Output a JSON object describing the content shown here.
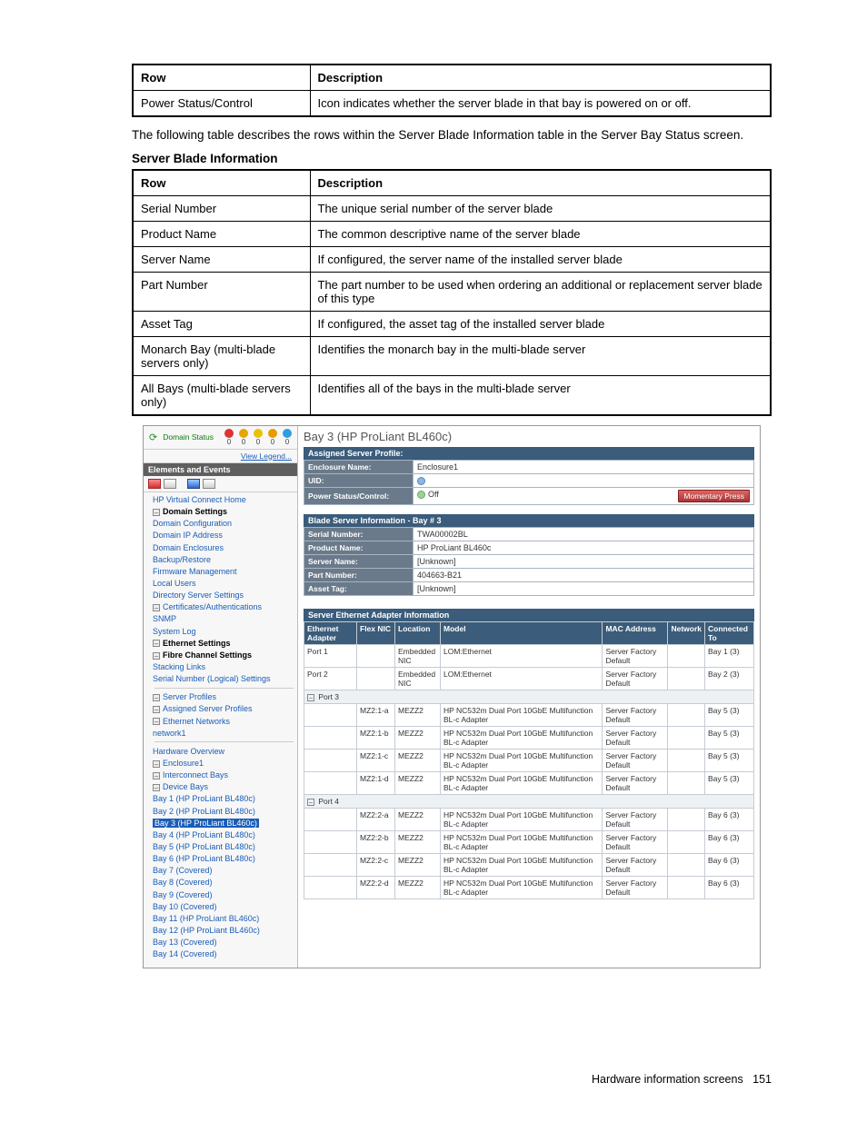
{
  "table1": {
    "headers": [
      "Row",
      "Description"
    ],
    "rows": [
      [
        "Power Status/Control",
        "Icon indicates whether the server blade in that bay is powered on or off."
      ]
    ]
  },
  "para1": "The following table describes the rows within the Server Blade Information table in the Server Bay Status screen.",
  "subhead1": "Server Blade Information",
  "table2": {
    "headers": [
      "Row",
      "Description"
    ],
    "rows": [
      [
        "Serial Number",
        "The unique serial number of the server blade"
      ],
      [
        "Product Name",
        "The common descriptive name of the server blade"
      ],
      [
        "Server Name",
        "If configured, the server name of the installed server blade"
      ],
      [
        "Part Number",
        "The part number to be used when ordering an additional or replacement server blade of this type"
      ],
      [
        "Asset Tag",
        "If configured, the asset tag of the installed server blade"
      ],
      [
        "Monarch Bay (multi-blade servers only)",
        "Identifies the monarch bay in the multi-blade server"
      ],
      [
        "All Bays (multi-blade servers only)",
        "Identifies all of the bays in the multi-blade server"
      ]
    ]
  },
  "shot": {
    "status": {
      "label": "Domain Status",
      "counts": [
        "0",
        "0",
        "0",
        "0",
        "0"
      ]
    },
    "view_legend": "View Legend...",
    "side_header": "Elements and Events",
    "tree": {
      "vc_home": "HP Virtual Connect Home",
      "domain_settings": "Domain Settings",
      "domain_config": "Domain Configuration",
      "domain_ip": "Domain IP Address",
      "domain_enc": "Domain Enclosures",
      "backup": "Backup/Restore",
      "fw": "Firmware Management",
      "local_users": "Local Users",
      "dir_set": "Directory Server Settings",
      "certs": "Certificates/Authentications",
      "snmp": "SNMP",
      "syslog": "System Log",
      "eth_set": "Ethernet Settings",
      "fc_set": "Fibre Channel Settings",
      "stack": "Stacking Links",
      "sn_log": "Serial Number (Logical) Settings",
      "srv_prof": "Server Profiles",
      "asgn_prof": "Assigned Server Profiles",
      "eth_net": "Ethernet Networks",
      "net1": "network1",
      "hw_ov": "Hardware Overview",
      "enc1": "Enclosure1",
      "int_bays": "Interconnect Bays",
      "dev_bays": "Device Bays",
      "bays": [
        "Bay 1 (HP ProLiant BL480c)",
        "Bay 2 (HP ProLiant BL480c)",
        "Bay 3 (HP ProLiant BL460c)",
        "Bay 4 (HP ProLiant BL480c)",
        "Bay 5 (HP ProLiant BL480c)",
        "Bay 6 (HP ProLiant BL480c)",
        "Bay 7 (Covered)",
        "Bay 8 (Covered)",
        "Bay 9 (Covered)",
        "Bay 10 (Covered)",
        "Bay 11 (HP ProLiant BL460c)",
        "Bay 12 (HP ProLiant BL460c)",
        "Bay 13 (Covered)",
        "Bay 14 (Covered)"
      ]
    },
    "main": {
      "title": "Bay 3 (HP ProLiant BL460c)",
      "profile_head": "Assigned Server Profile:",
      "rows1": [
        {
          "label": "Enclosure Name:",
          "value": "Enclosure1"
        },
        {
          "label": "UID:",
          "value": ""
        },
        {
          "label": "Power Status/Control:",
          "value": "Off",
          "btn": "Momentary Press"
        }
      ],
      "info_head": "Blade Server Information - Bay # 3",
      "rows2": [
        {
          "label": "Serial Number:",
          "value": "TWA00002BL"
        },
        {
          "label": "Product Name:",
          "value": "HP ProLiant BL460c"
        },
        {
          "label": "Server Name:",
          "value": "[Unknown]"
        },
        {
          "label": "Part Number:",
          "value": "404663-B21"
        },
        {
          "label": "Asset Tag:",
          "value": "[Unknown]"
        }
      ],
      "eth_head": "Server Ethernet Adapter Information",
      "eth_cols": [
        "Ethernet Adapter",
        "Flex NIC",
        "Location",
        "Model",
        "MAC Address",
        "Network",
        "Connected To"
      ],
      "eth_rows": [
        {
          "adapter": "Port 1",
          "flex": "",
          "loc": "Embedded NIC",
          "model": "LOM:Ethernet",
          "mac": "Server Factory Default",
          "net": "",
          "conn": "Bay 1 (3)"
        },
        {
          "adapter": "Port 2",
          "flex": "",
          "loc": "Embedded NIC",
          "model": "LOM:Ethernet",
          "mac": "Server Factory Default",
          "net": "",
          "conn": "Bay 2 (3)"
        },
        {
          "group": "Port 3"
        },
        {
          "adapter": "",
          "flex": "MZ2:1-a",
          "loc": "MEZZ2",
          "model": "HP NC532m Dual Port 10GbE Multifunction BL-c Adapter",
          "mac": "Server Factory Default",
          "net": "",
          "conn": "Bay 5 (3)"
        },
        {
          "adapter": "",
          "flex": "MZ2:1-b",
          "loc": "MEZZ2",
          "model": "HP NC532m Dual Port 10GbE Multifunction BL-c Adapter",
          "mac": "Server Factory Default",
          "net": "",
          "conn": "Bay 5 (3)"
        },
        {
          "adapter": "",
          "flex": "MZ2:1-c",
          "loc": "MEZZ2",
          "model": "HP NC532m Dual Port 10GbE Multifunction BL-c Adapter",
          "mac": "Server Factory Default",
          "net": "",
          "conn": "Bay 5 (3)"
        },
        {
          "adapter": "",
          "flex": "MZ2:1-d",
          "loc": "MEZZ2",
          "model": "HP NC532m Dual Port 10GbE Multifunction BL-c Adapter",
          "mac": "Server Factory Default",
          "net": "",
          "conn": "Bay 5 (3)"
        },
        {
          "group": "Port 4"
        },
        {
          "adapter": "",
          "flex": "MZ2:2-a",
          "loc": "MEZZ2",
          "model": "HP NC532m Dual Port 10GbE Multifunction BL-c Adapter",
          "mac": "Server Factory Default",
          "net": "",
          "conn": "Bay 6 (3)"
        },
        {
          "adapter": "",
          "flex": "MZ2:2-b",
          "loc": "MEZZ2",
          "model": "HP NC532m Dual Port 10GbE Multifunction BL-c Adapter",
          "mac": "Server Factory Default",
          "net": "",
          "conn": "Bay 6 (3)"
        },
        {
          "adapter": "",
          "flex": "MZ2:2-c",
          "loc": "MEZZ2",
          "model": "HP NC532m Dual Port 10GbE Multifunction BL-c Adapter",
          "mac": "Server Factory Default",
          "net": "",
          "conn": "Bay 6 (3)"
        },
        {
          "adapter": "",
          "flex": "MZ2:2-d",
          "loc": "MEZZ2",
          "model": "HP NC532m Dual Port 10GbE Multifunction BL-c Adapter",
          "mac": "Server Factory Default",
          "net": "",
          "conn": "Bay 6 (3)"
        }
      ]
    }
  },
  "footer": {
    "text": "Hardware information screens",
    "page": "151"
  }
}
